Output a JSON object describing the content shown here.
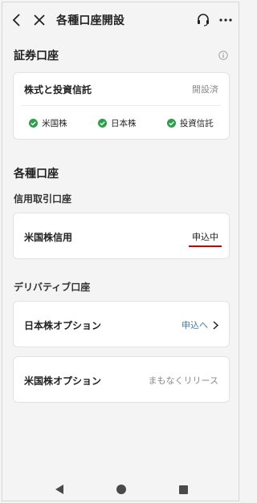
{
  "header": {
    "title": "各種口座開設",
    "back_icon": "chevron-left-icon",
    "close_icon": "close-icon",
    "support_icon": "headset-icon",
    "more_icon": "more-icon"
  },
  "securities_section": {
    "title": "証券口座",
    "card": {
      "label": "株式と投資信託",
      "status": "開設済",
      "markets": [
        "米国株",
        "日本株",
        "投資信託"
      ]
    }
  },
  "accounts_section": {
    "title": "各種口座",
    "margin_title": "信用取引口座",
    "margin_card": {
      "label": "米国株信用",
      "status": "申込中"
    },
    "derivative_title": "デリバティブ口座",
    "jp_option_card": {
      "label": "日本株オプション",
      "action": "申込へ"
    },
    "us_option_card": {
      "label": "米国株オプション",
      "status": "まもなくリリース"
    }
  },
  "colors": {
    "check_green": "#2aa148",
    "link_blue": "#3d7fc2",
    "underline_red": "#d40000"
  }
}
